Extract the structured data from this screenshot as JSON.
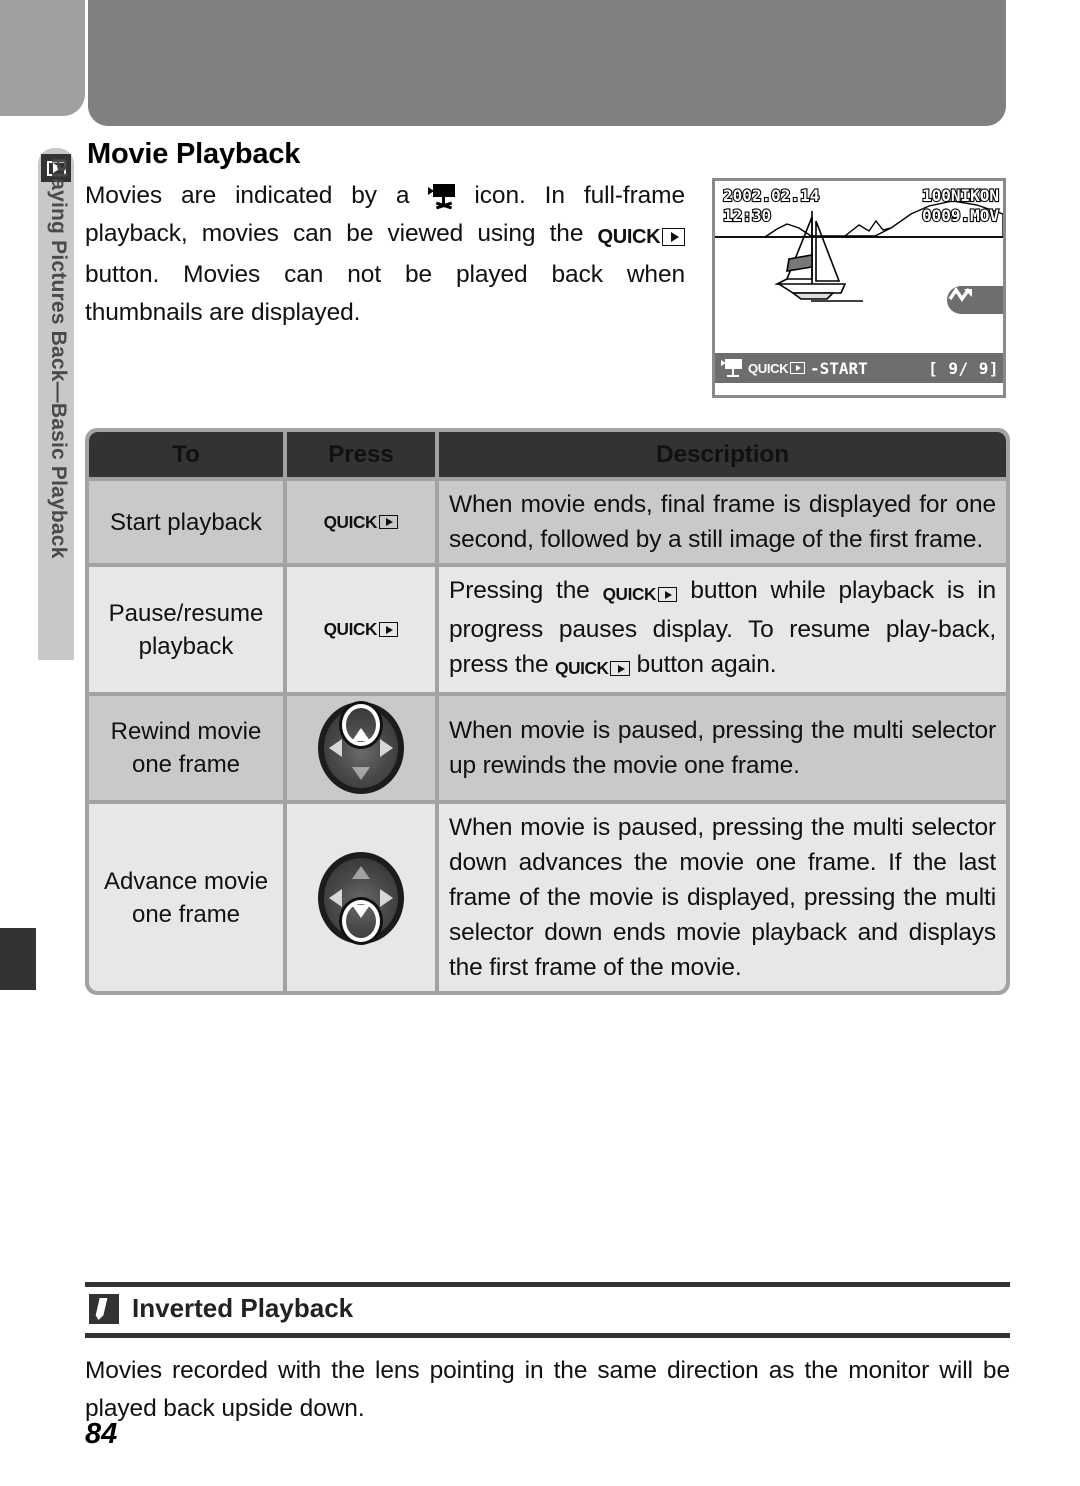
{
  "sidebar": {
    "icon": "playback-play-icon",
    "label": "Playing Pictures Back—Basic Playback"
  },
  "page": {
    "title": "Movie Playback",
    "number": "84"
  },
  "intro": {
    "part1": "Movies are indicated by a ",
    "icon1": "movie-camera-icon",
    "part2": " icon.  In full-frame playback, movies can be viewed using the ",
    "quick_label": "QUICK",
    "part3": " button.  Movies can not be played back when thumbnails are displayed."
  },
  "lcd": {
    "date": "2002.02.14",
    "time": "12:30",
    "folder": "100NIKON",
    "filename": "0009.MOV",
    "badge_icon": "movie-indicator-icon",
    "status_icon": "movie-camera-icon",
    "status_quick": "QUICK",
    "status_action": "-START",
    "counter": "[    9/    9]"
  },
  "table": {
    "headers": [
      "To",
      "Press",
      "Description"
    ],
    "rows": [
      {
        "to": "Start playback",
        "press_type": "quick",
        "press_label": "QUICK",
        "description_pre": "When movie ends, final frame is displayed for one second, followed by a still image of the first frame."
      },
      {
        "to": "Pause/resume playback",
        "press_type": "quick",
        "press_label": "QUICK",
        "desc_a": "Pressing the ",
        "desc_b": " button while playback is in progress pauses display.  To resume play-back, press the ",
        "desc_c": " button again."
      },
      {
        "to": "Rewind movie one frame",
        "press_type": "multiselector-up",
        "description_pre": "When movie is paused, pressing the multi selector up rewinds the movie one frame."
      },
      {
        "to": "Advance movie one frame",
        "press_type": "multiselector-down",
        "description_pre": "When movie is paused, pressing the multi selector down advances the movie one frame.  If the last frame of the movie is displayed, pressing the multi selector down ends movie playback and displays the first frame of the movie."
      }
    ]
  },
  "note": {
    "icon": "pencil-icon",
    "heading": "Inverted Playback",
    "body": "Movies recorded with the lens pointing in the same direction as the monitor will be played back upside down."
  }
}
